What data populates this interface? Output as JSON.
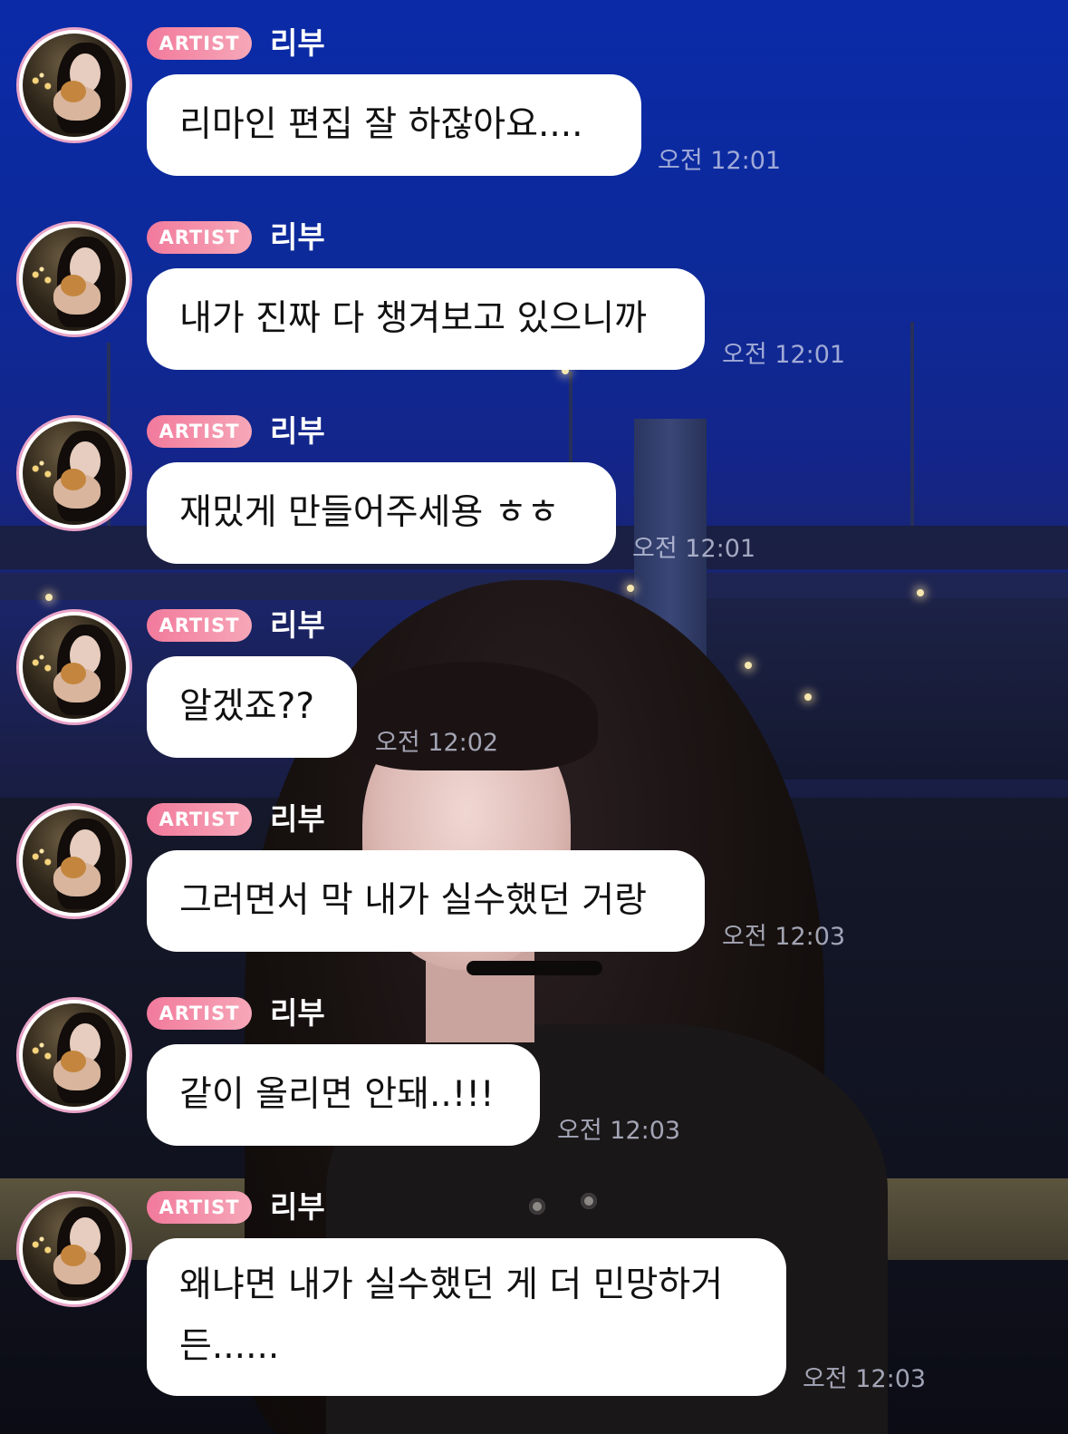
{
  "sender": {
    "badge": "ARTIST",
    "name": "리부"
  },
  "messages": [
    {
      "text": "리마인 편집 잘 하잖아요....",
      "time": "오전 12:01"
    },
    {
      "text": "내가 진짜 다 챙겨보고 있으니까",
      "time": "오전 12:01"
    },
    {
      "text": "재밌게 만들어주세용 ㅎㅎ",
      "time": "오전 12:01"
    },
    {
      "text": "알겠죠??",
      "time": "오전 12:02"
    },
    {
      "text": "그러면서 막 내가 실수했던 거랑",
      "time": "오전 12:03"
    },
    {
      "text": "같이 올리면 안돼..!!!",
      "time": "오전 12:03"
    },
    {
      "text_line1": "왜냐면 내가 실수했던 게 더 민망하거",
      "text_line2": "든......",
      "time": "오전 12:03"
    }
  ]
}
